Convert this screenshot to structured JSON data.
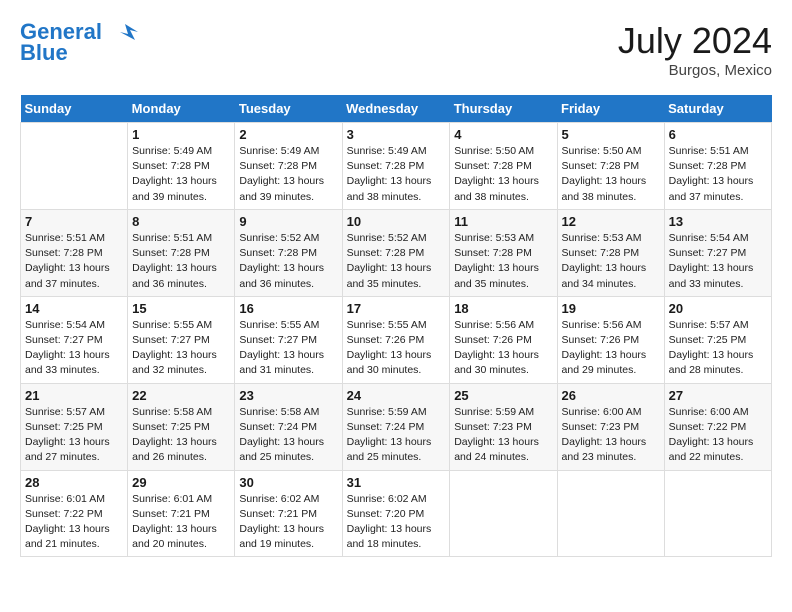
{
  "header": {
    "logo_line1": "General",
    "logo_line2": "Blue",
    "month_year": "July 2024",
    "location": "Burgos, Mexico"
  },
  "days_of_week": [
    "Sunday",
    "Monday",
    "Tuesday",
    "Wednesday",
    "Thursday",
    "Friday",
    "Saturday"
  ],
  "weeks": [
    [
      {
        "num": "",
        "info": ""
      },
      {
        "num": "1",
        "info": "Sunrise: 5:49 AM\nSunset: 7:28 PM\nDaylight: 13 hours\nand 39 minutes."
      },
      {
        "num": "2",
        "info": "Sunrise: 5:49 AM\nSunset: 7:28 PM\nDaylight: 13 hours\nand 39 minutes."
      },
      {
        "num": "3",
        "info": "Sunrise: 5:49 AM\nSunset: 7:28 PM\nDaylight: 13 hours\nand 38 minutes."
      },
      {
        "num": "4",
        "info": "Sunrise: 5:50 AM\nSunset: 7:28 PM\nDaylight: 13 hours\nand 38 minutes."
      },
      {
        "num": "5",
        "info": "Sunrise: 5:50 AM\nSunset: 7:28 PM\nDaylight: 13 hours\nand 38 minutes."
      },
      {
        "num": "6",
        "info": "Sunrise: 5:51 AM\nSunset: 7:28 PM\nDaylight: 13 hours\nand 37 minutes."
      }
    ],
    [
      {
        "num": "7",
        "info": "Sunrise: 5:51 AM\nSunset: 7:28 PM\nDaylight: 13 hours\nand 37 minutes."
      },
      {
        "num": "8",
        "info": "Sunrise: 5:51 AM\nSunset: 7:28 PM\nDaylight: 13 hours\nand 36 minutes."
      },
      {
        "num": "9",
        "info": "Sunrise: 5:52 AM\nSunset: 7:28 PM\nDaylight: 13 hours\nand 36 minutes."
      },
      {
        "num": "10",
        "info": "Sunrise: 5:52 AM\nSunset: 7:28 PM\nDaylight: 13 hours\nand 35 minutes."
      },
      {
        "num": "11",
        "info": "Sunrise: 5:53 AM\nSunset: 7:28 PM\nDaylight: 13 hours\nand 35 minutes."
      },
      {
        "num": "12",
        "info": "Sunrise: 5:53 AM\nSunset: 7:28 PM\nDaylight: 13 hours\nand 34 minutes."
      },
      {
        "num": "13",
        "info": "Sunrise: 5:54 AM\nSunset: 7:27 PM\nDaylight: 13 hours\nand 33 minutes."
      }
    ],
    [
      {
        "num": "14",
        "info": "Sunrise: 5:54 AM\nSunset: 7:27 PM\nDaylight: 13 hours\nand 33 minutes."
      },
      {
        "num": "15",
        "info": "Sunrise: 5:55 AM\nSunset: 7:27 PM\nDaylight: 13 hours\nand 32 minutes."
      },
      {
        "num": "16",
        "info": "Sunrise: 5:55 AM\nSunset: 7:27 PM\nDaylight: 13 hours\nand 31 minutes."
      },
      {
        "num": "17",
        "info": "Sunrise: 5:55 AM\nSunset: 7:26 PM\nDaylight: 13 hours\nand 30 minutes."
      },
      {
        "num": "18",
        "info": "Sunrise: 5:56 AM\nSunset: 7:26 PM\nDaylight: 13 hours\nand 30 minutes."
      },
      {
        "num": "19",
        "info": "Sunrise: 5:56 AM\nSunset: 7:26 PM\nDaylight: 13 hours\nand 29 minutes."
      },
      {
        "num": "20",
        "info": "Sunrise: 5:57 AM\nSunset: 7:25 PM\nDaylight: 13 hours\nand 28 minutes."
      }
    ],
    [
      {
        "num": "21",
        "info": "Sunrise: 5:57 AM\nSunset: 7:25 PM\nDaylight: 13 hours\nand 27 minutes."
      },
      {
        "num": "22",
        "info": "Sunrise: 5:58 AM\nSunset: 7:25 PM\nDaylight: 13 hours\nand 26 minutes."
      },
      {
        "num": "23",
        "info": "Sunrise: 5:58 AM\nSunset: 7:24 PM\nDaylight: 13 hours\nand 25 minutes."
      },
      {
        "num": "24",
        "info": "Sunrise: 5:59 AM\nSunset: 7:24 PM\nDaylight: 13 hours\nand 25 minutes."
      },
      {
        "num": "25",
        "info": "Sunrise: 5:59 AM\nSunset: 7:23 PM\nDaylight: 13 hours\nand 24 minutes."
      },
      {
        "num": "26",
        "info": "Sunrise: 6:00 AM\nSunset: 7:23 PM\nDaylight: 13 hours\nand 23 minutes."
      },
      {
        "num": "27",
        "info": "Sunrise: 6:00 AM\nSunset: 7:22 PM\nDaylight: 13 hours\nand 22 minutes."
      }
    ],
    [
      {
        "num": "28",
        "info": "Sunrise: 6:01 AM\nSunset: 7:22 PM\nDaylight: 13 hours\nand 21 minutes."
      },
      {
        "num": "29",
        "info": "Sunrise: 6:01 AM\nSunset: 7:21 PM\nDaylight: 13 hours\nand 20 minutes."
      },
      {
        "num": "30",
        "info": "Sunrise: 6:02 AM\nSunset: 7:21 PM\nDaylight: 13 hours\nand 19 minutes."
      },
      {
        "num": "31",
        "info": "Sunrise: 6:02 AM\nSunset: 7:20 PM\nDaylight: 13 hours\nand 18 minutes."
      },
      {
        "num": "",
        "info": ""
      },
      {
        "num": "",
        "info": ""
      },
      {
        "num": "",
        "info": ""
      }
    ]
  ]
}
